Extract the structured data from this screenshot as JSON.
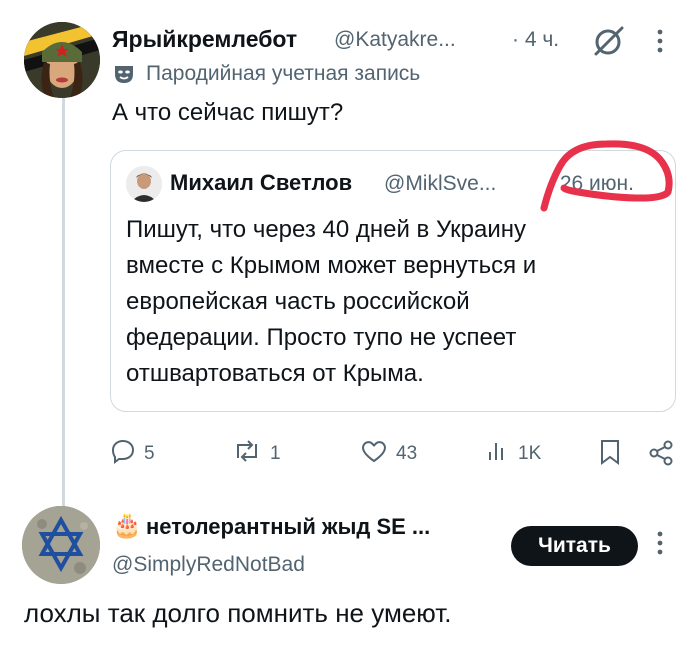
{
  "tweet1": {
    "display_name": "Ярыйкремлебот",
    "handle": "@Katyakre...",
    "time": "· 4 ч.",
    "parody_label": "Пародийная учетная запись",
    "text": "А что сейчас пишут?",
    "actions": {
      "replies": "5",
      "reposts": "1",
      "likes": "43",
      "views": "1K"
    }
  },
  "quoted": {
    "display_name": "Михаил Светлов",
    "handle": "@MiklSve...",
    "date": "· 26 июн.",
    "text": "Пишут, что через 40 дней в Украину вместе с Крымом может вернуться и европейская часть российской федерации. Просто тупо не успеет отшвартоваться от Крыма."
  },
  "tweet2": {
    "display_name": "нетолерантный жыд SE ...",
    "emoji": "🎂",
    "handle": "@SimplyRedNotBad",
    "follow_label": "Читать",
    "text": "лохлы так долго помнить не умеют."
  },
  "colors": {
    "text": "#0f1419",
    "muted": "#536471",
    "border": "#cfd9de",
    "annotation": "#e8314a"
  }
}
